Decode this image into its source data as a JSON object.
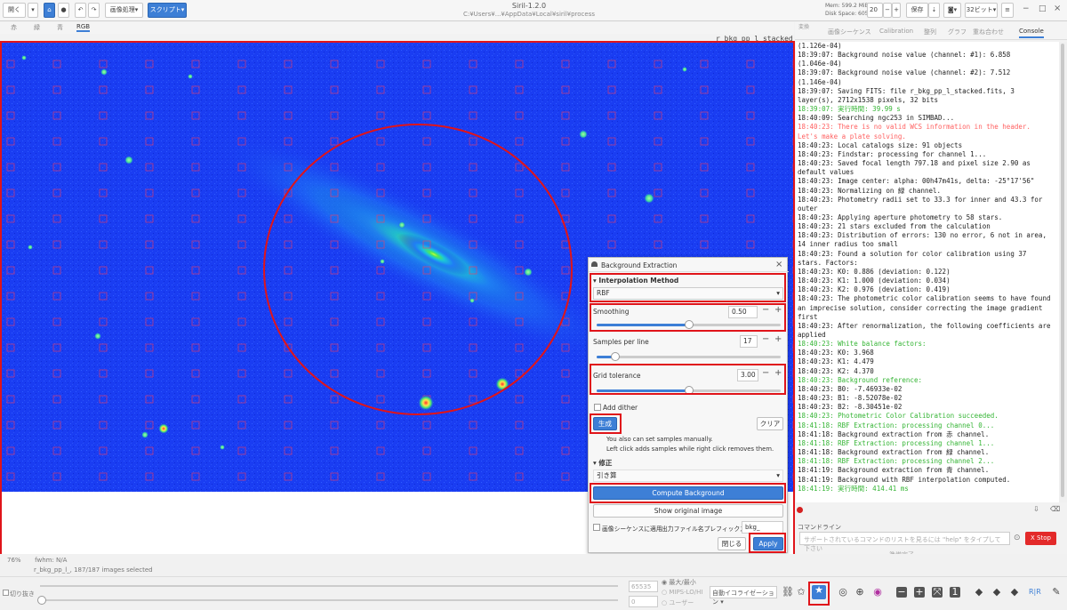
{
  "toolbar": {
    "open_label": "開く",
    "image_processing_label": "画像処理",
    "script_label": "スクリプト",
    "title": "Siril-1.2.0",
    "subtitle": "C:¥Users¥...¥AppData¥Local¥siril¥process",
    "mem_label": "Mem: 599.2 MiB",
    "disk_label": "Disk Space: 605.2 GB",
    "threads_value": "20",
    "save_label": "保存",
    "bits_label": "32ビット"
  },
  "channel_tabs": [
    "赤",
    "緑",
    "青",
    "RGB"
  ],
  "image_filename": "r_bkg_pp_l_stacked",
  "right_tabs": [
    "変換",
    "画像シーケンス",
    "Calibration",
    "整列",
    "グラフ",
    "重ね合わせ",
    "Console"
  ],
  "console_lines": [
    {
      "text": "(1.126e-04)",
      "color": "normal"
    },
    {
      "text": "18:39:07: Background noise value (channel: #1): 6.858",
      "color": "normal"
    },
    {
      "text": "(1.046e-04)",
      "color": "normal"
    },
    {
      "text": "18:39:07: Background noise value (channel: #2): 7.512",
      "color": "normal"
    },
    {
      "text": "(1.146e-04)",
      "color": "normal"
    },
    {
      "text": "18:39:07: Saving FITS: file r_bkg_pp_l_stacked.fits, 3",
      "color": "normal"
    },
    {
      "text": "layer(s), 2712x1538 pixels, 32 bits",
      "color": "normal"
    },
    {
      "text": "18:39:07: 実行時間: 39.99 s",
      "color": "green"
    },
    {
      "text": "18:40:09: Searching ngc253 in SIMBAD...",
      "color": "normal"
    },
    {
      "text": "18:40:23: There is no valid WCS information in the header.",
      "color": "red"
    },
    {
      "text": "Let's make a plate solving.",
      "color": "red"
    },
    {
      "text": "18:40:23: Local catalogs size: 91 objects",
      "color": "normal"
    },
    {
      "text": "18:40:23: Findstar: processing for channel 1...",
      "color": "normal"
    },
    {
      "text": "18:40:23: Saved focal length 797.18 and pixel size 2.90 as",
      "color": "normal"
    },
    {
      "text": "default values",
      "color": "normal"
    },
    {
      "text": "18:40:23: Image center: alpha: 00h47m41s, delta: -25°17'56\"",
      "color": "normal"
    },
    {
      "text": "18:40:23: Normalizing on 緑 channel.",
      "color": "normal"
    },
    {
      "text": "18:40:23: Photometry radii set to 33.3 for inner and 43.3 for",
      "color": "normal"
    },
    {
      "text": "outer",
      "color": "normal"
    },
    {
      "text": "18:40:23: Applying aperture photometry to 58 stars.",
      "color": "normal"
    },
    {
      "text": "18:40:23: 21 stars excluded from the calculation",
      "color": "normal"
    },
    {
      "text": "18:40:23: Distribution of errors: 130 no error, 6 not in area,",
      "color": "normal"
    },
    {
      "text": "14 inner radius too small",
      "color": "normal"
    },
    {
      "text": "18:40:23: Found a solution for color calibration using 37",
      "color": "normal"
    },
    {
      "text": "stars. Factors:",
      "color": "normal"
    },
    {
      "text": "18:40:23: K0: 0.886      (deviation: 0.122)",
      "color": "normal"
    },
    {
      "text": "18:40:23: K1: 1.000      (deviation: 0.034)",
      "color": "normal"
    },
    {
      "text": "18:40:23: K2: 0.976      (deviation: 0.419)",
      "color": "normal"
    },
    {
      "text": "18:40:23: The photometric color calibration seems to have found",
      "color": "normal"
    },
    {
      "text": "an imprecise solution, consider correcting the image gradient",
      "color": "normal"
    },
    {
      "text": "first",
      "color": "normal"
    },
    {
      "text": "18:40:23: After renormalization, the following coefficients are",
      "color": "normal"
    },
    {
      "text": "applied",
      "color": "normal"
    },
    {
      "text": "18:40:23: White balance factors:",
      "color": "green"
    },
    {
      "text": "18:40:23: K0: 3.968",
      "color": "normal"
    },
    {
      "text": "18:40:23: K1: 4.479",
      "color": "normal"
    },
    {
      "text": "18:40:23: K2: 4.370",
      "color": "normal"
    },
    {
      "text": "18:40:23: Background reference:",
      "color": "green"
    },
    {
      "text": "18:40:23: B0: -7.46933e-02",
      "color": "normal"
    },
    {
      "text": "18:40:23: B1: -8.52078e-02",
      "color": "normal"
    },
    {
      "text": "18:40:23: B2: -8.30451e-02",
      "color": "normal"
    },
    {
      "text": "18:40:23: Photometric Color Calibration succeeded.",
      "color": "green"
    },
    {
      "text": "18:41:18: RBF Extraction: processing channel 0...",
      "color": "green"
    },
    {
      "text": "18:41:18: Background extraction from 赤 channel.",
      "color": "normal"
    },
    {
      "text": "18:41:18: RBF Extraction: processing channel 1...",
      "color": "green"
    },
    {
      "text": "18:41:18: Background extraction from 緑 channel.",
      "color": "normal"
    },
    {
      "text": "18:41:18: RBF Extraction: processing channel 2...",
      "color": "green"
    },
    {
      "text": "18:41:19: Background extraction from 青 channel.",
      "color": "normal"
    },
    {
      "text": "18:41:19: Background with RBF interpolation computed.",
      "color": "normal"
    },
    {
      "text": "18:41:19: 実行時間: 414.41 ms",
      "color": "green"
    }
  ],
  "command": {
    "label": "コマンドライン",
    "placeholder": "サポートされているコマンドのリストを見るには \"help\" をタイプして下さい",
    "stop_label": "X Stop",
    "status": "準備完了."
  },
  "dialog": {
    "title": "Background Extraction",
    "interp_header": "Interpolation Method",
    "interp_value": "RBF",
    "smoothing_label": "Smoothing",
    "smoothing_value": "0.50",
    "smoothing_fraction": 0.5,
    "samples_label": "Samples per line",
    "samples_value": "17",
    "samples_fraction": 0.1,
    "tolerance_label": "Grid tolerance",
    "tolerance_value": "3.00",
    "tolerance_fraction": 0.5,
    "add_dither": "Add dither",
    "generate_label": "生成",
    "clear_label": "クリア",
    "hint1": "You also can set samples manually.",
    "hint2": "Left click adds samples while right click removes them.",
    "correction_header": "修正",
    "correction_value": "引き算",
    "compute_label": "Compute Background",
    "show_original_label": "Show original image",
    "apply_seq_label": "画像シーケンスに適用",
    "prefix_label": "出力ファイル名プレフィックス:",
    "prefix_value": "bkg_",
    "close_label": "閉じる",
    "apply_label": "Apply"
  },
  "status": {
    "zoom": "76%",
    "fwhm": "fwhm: N/A",
    "sequence": "r_bkg_pp_l_, 187/187 images selected",
    "crop_label": "切り抜き",
    "scale_value": "65535",
    "scale_min": "0",
    "mode_minmax": "最大/最小",
    "mode_mips": "MIPS-LO/HI",
    "mode_user": "ユーザー",
    "autostretch_label": "自動イコライゼーション"
  },
  "colors": {
    "accent": "#3d7fd6",
    "highlight_red": "#e0141a",
    "image_bg": "#1a3df2",
    "console_green": "#35b535",
    "console_red": "#ff6060"
  }
}
